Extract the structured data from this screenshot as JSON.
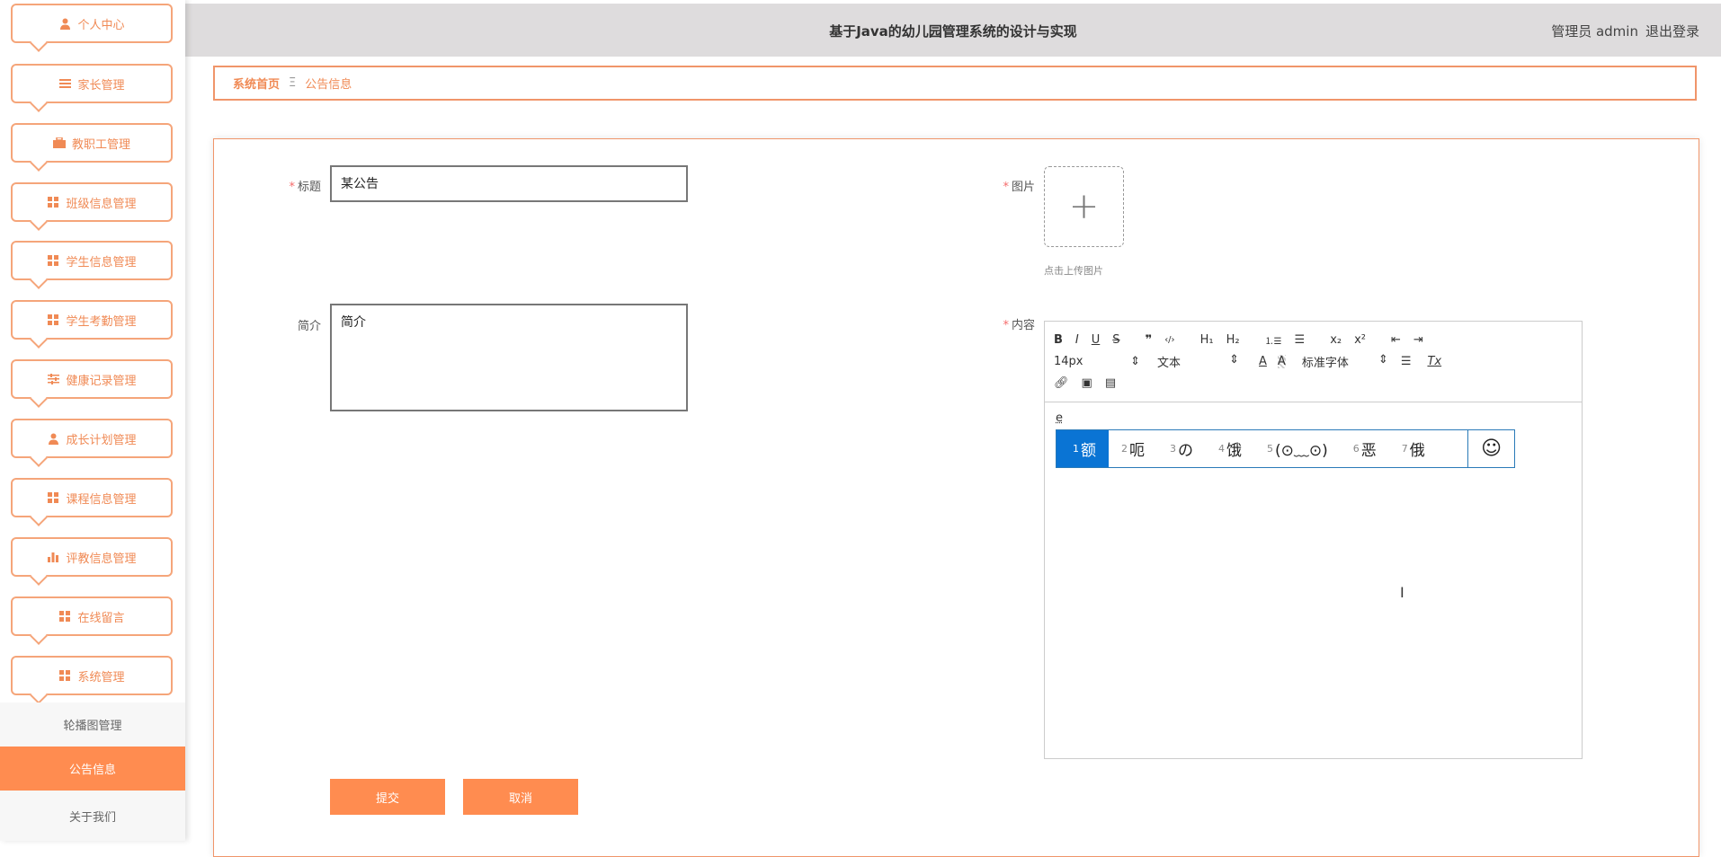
{
  "header": {
    "title": "基于Java的幼儿园管理系统的设计与实现",
    "user": "管理员 admin",
    "logout": "退出登录"
  },
  "sidebar": {
    "items": [
      {
        "label": "个人中心",
        "icon": "person-icon"
      },
      {
        "label": "家长管理",
        "icon": "list-icon"
      },
      {
        "label": "教职工管理",
        "icon": "briefcase-icon"
      },
      {
        "label": "班级信息管理",
        "icon": "grid-icon"
      },
      {
        "label": "学生信息管理",
        "icon": "grid-icon"
      },
      {
        "label": "学生考勤管理",
        "icon": "grid-icon"
      },
      {
        "label": "健康记录管理",
        "icon": "sliders-icon"
      },
      {
        "label": "成长计划管理",
        "icon": "person-icon"
      },
      {
        "label": "课程信息管理",
        "icon": "grid-icon"
      },
      {
        "label": "评教信息管理",
        "icon": "bar-chart-icon"
      },
      {
        "label": "在线留言",
        "icon": "grid-icon"
      },
      {
        "label": "系统管理",
        "icon": "grid-icon"
      }
    ],
    "submenu": [
      {
        "label": "轮播图管理"
      },
      {
        "label": "公告信息",
        "active": true
      },
      {
        "label": "关于我们"
      }
    ]
  },
  "breadcrumb": {
    "home": "系统首页",
    "sep": "Ξ",
    "current": "公告信息"
  },
  "form": {
    "title_label": "标题",
    "title_value": "某公告",
    "intro_label": "简介",
    "intro_value": "简介",
    "image_label": "图片",
    "upload_hint": "点击上传图片",
    "upload_plus": "+",
    "content_label": "内容",
    "required_mark": "*",
    "content_text": "e",
    "submit": "提交",
    "cancel": "取消"
  },
  "editor": {
    "row1": [
      "B",
      "I",
      "U",
      "S",
      "❞",
      "‹/›",
      "H₁",
      "H₂",
      "⒈☰",
      "☰",
      "x₂",
      "x²",
      "⇤",
      "⇥"
    ],
    "font_size": "14px",
    "block": "文本",
    "font": "标准字体",
    "color_a": "A",
    "bg_a": "A",
    "clear": "Tx"
  },
  "ime": {
    "candidates": [
      {
        "n": "1",
        "t": "额"
      },
      {
        "n": "2",
        "t": "呃"
      },
      {
        "n": "3",
        "t": "の"
      },
      {
        "n": "4",
        "t": "饿"
      },
      {
        "n": "5",
        "t": "(⊙﹏⊙)"
      },
      {
        "n": "6",
        "t": "恶"
      },
      {
        "n": "7",
        "t": "俄"
      }
    ],
    "emoji": "☺"
  },
  "colors": {
    "accent": "#ff8c50",
    "header_bg": "#dedcdd",
    "ime_selected": "#0a74d4"
  }
}
